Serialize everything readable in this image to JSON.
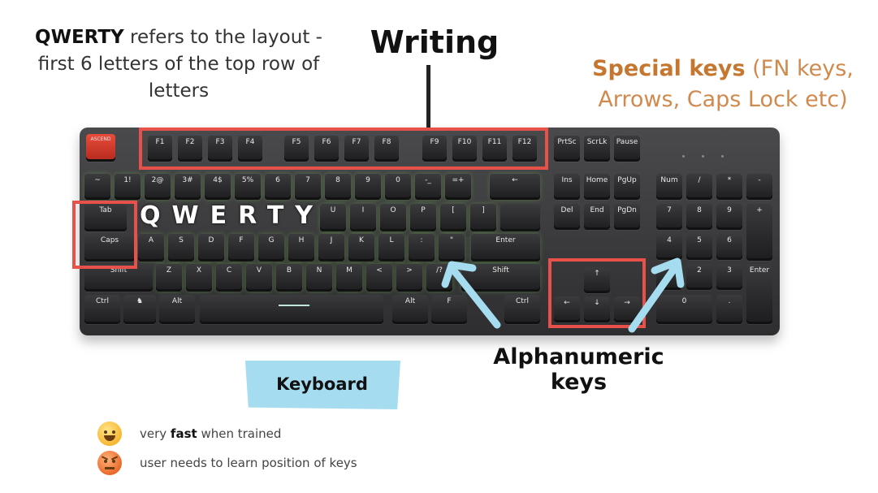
{
  "notes": {
    "qwerty_bold": "QWERTY",
    "qwerty_rest": " refers to the layout - first 6 letters of the top row of letters",
    "writing": "Writing",
    "special_bold": "Special keys",
    "special_rest": " (FN keys, Arrows, Caps Lock etc)",
    "alphanumeric": "Alphanumeric keys",
    "keyboard_tag": "Keyboard",
    "qwerty_overlay": "QWERTY"
  },
  "pros_cons": [
    {
      "icon": "happy-emoji-icon",
      "before": "very ",
      "bold": "fast",
      "after": " when trained"
    },
    {
      "icon": "angry-emoji-icon",
      "before": "user needs to learn position of keys",
      "bold": "",
      "after": ""
    }
  ],
  "keys": {
    "esc": "ASCEND",
    "f1": "F1",
    "f2": "F2",
    "f3": "F3",
    "f4": "F4",
    "f5": "F5",
    "f6": "F6",
    "f7": "F7",
    "f8": "F8",
    "f9": "F9",
    "f10": "F10",
    "f11": "F11",
    "f12": "F12",
    "prtsc": "PrtSc",
    "scrlk": "ScrLk",
    "pause": "Pause",
    "tab": "Tab",
    "caps": "Caps",
    "shift_l": "Shift",
    "shift_r": "Shift",
    "ctrl_l": "Ctrl",
    "alt_l": "Alt",
    "alt_r": "Alt",
    "fn": "F",
    "ctrl_r": "Ctrl",
    "enter": "Enter",
    "ins": "Ins",
    "home": "Home",
    "pgup": "PgUp",
    "del": "Del",
    "end": "End",
    "pgdn": "PgDn",
    "num": "Num",
    "num_slash": "/",
    "num_star": "*",
    "num_minus": "-",
    "num_plus": "+",
    "num7": "7",
    "num8": "8",
    "num9": "9",
    "num4": "4",
    "num5": "5",
    "num6": "6",
    "num1": "1",
    "num2": "2",
    "num3": "3",
    "num0": "0",
    "num_dot": ".",
    "num_enter": "Enter",
    "row_num": [
      "~",
      "1!",
      "2@",
      "3#",
      "4$",
      "5%",
      "6",
      "7",
      "8",
      "9",
      "0",
      "-_",
      "=+"
    ],
    "row_q_rest": [
      "U",
      "I",
      "O",
      "P",
      "[",
      "]"
    ],
    "row_a": [
      "A",
      "S",
      "D",
      "F",
      "G",
      "H",
      "J",
      "K",
      "L",
      ":",
      "\""
    ],
    "row_z": [
      "Z",
      "X",
      "C",
      "V",
      "B",
      "N",
      "M",
      "<",
      ">",
      "/?"
    ],
    "arrow_up": "↑",
    "arrow_left": "←",
    "arrow_down": "↓",
    "arrow_right": "→"
  },
  "colors": {
    "highlight": "#e8504a",
    "special_text": "#c5762f",
    "arrow": "#a5dcef",
    "tag_bg": "#a5dcef"
  }
}
